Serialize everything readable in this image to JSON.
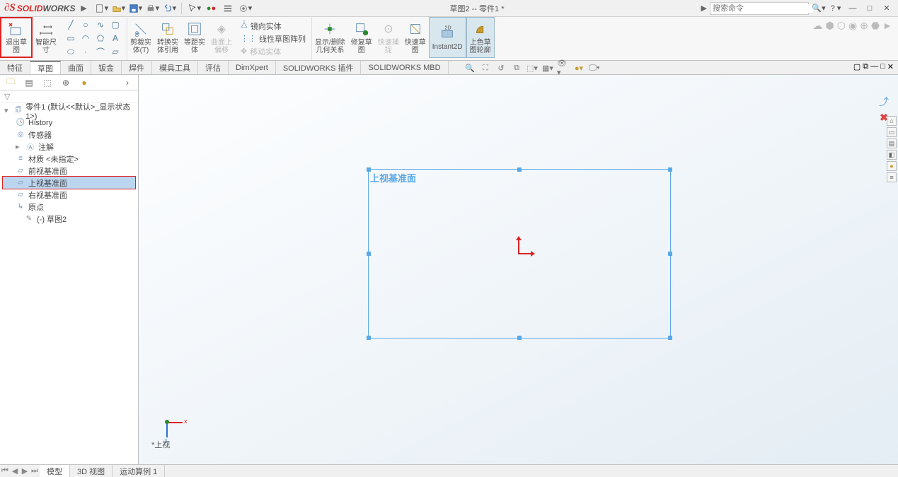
{
  "app": {
    "logo1": "SOLID",
    "logo2": "WORKS",
    "title": "草图2 -- 零件1 *"
  },
  "search": {
    "placeholder": "搜索命令"
  },
  "ribbon": {
    "exit_sketch": "退出草\n图",
    "smart_dim": "智能尺\n寸",
    "trim": "剪裁实\n体(T)",
    "convert": "转换实\n体引用",
    "offset": "等距实\n体",
    "surf_offset": "曲面上\n偏移",
    "mirror": "镜向实体",
    "linear_pat": "线性草图阵列",
    "move": "移动实体",
    "show_rel": "显示/删除\n几何关系",
    "repair": "修复草\n图",
    "quick_snap": "快速捕\n捉",
    "instant2d": "Instant2D",
    "shade": "上色草\n图轮廓"
  },
  "tabs": [
    "特征",
    "草图",
    "曲面",
    "钣金",
    "焊件",
    "模具工具",
    "评估",
    "DimXpert",
    "SOLIDWORKS 插件",
    "SOLIDWORKS MBD"
  ],
  "tree": {
    "root": "零件1  (默认<<默认>_显示状态 1>)",
    "history": "History",
    "sensors": "传感器",
    "annot": "注解",
    "material": "材质 <未指定>",
    "front": "前视基准面",
    "top": "上视基准面",
    "right": "右视基准面",
    "origin": "原点",
    "sketch": "(-) 草图2"
  },
  "canvas": {
    "plane_label": "上视基准面",
    "view_label": "*上视"
  },
  "bottom_tabs": [
    "模型",
    "3D 视图",
    "运动算例 1"
  ],
  "status": {
    "edit_mode": ""
  }
}
